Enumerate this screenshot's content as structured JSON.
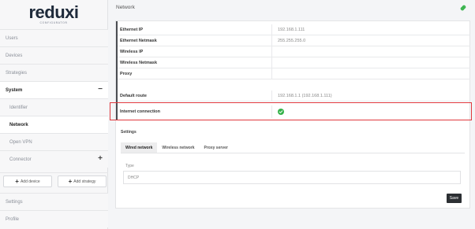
{
  "brand": {
    "logo": "reduxi",
    "tagline": "CONFIGURATOR"
  },
  "sidebar": {
    "items": [
      {
        "label": "Users"
      },
      {
        "label": "Devices"
      },
      {
        "label": "Strategies"
      },
      {
        "label": "System",
        "control": "−"
      },
      {
        "label": "Identifier"
      },
      {
        "label": "Network"
      },
      {
        "label": "Open VPN"
      },
      {
        "label": "Connector",
        "control": "+"
      }
    ],
    "add_device_label": "Add device",
    "add_strategy_label": "Add strategy",
    "settings_label": "Settings",
    "profile_label": "Profile"
  },
  "header": {
    "title": "Network",
    "link_icon": "link-icon"
  },
  "network": {
    "rows": [
      {
        "key": "Ethernet IP",
        "value": "192.168.1.111"
      },
      {
        "key": "Ethernet Netmask",
        "value": "255.255.255.0"
      },
      {
        "key": "Wireless IP",
        "value": ""
      },
      {
        "key": "Wireless Netmask",
        "value": ""
      },
      {
        "key": "Proxy",
        "value": ""
      },
      {
        "key": "Default route",
        "value": "192.168.1.1 (192.168.1.111)"
      },
      {
        "key": "Internet connection",
        "value": "",
        "status_icon": "check-circle-icon"
      }
    ]
  },
  "settings": {
    "label": "Settings",
    "tabs": [
      {
        "label": "Wired network"
      },
      {
        "label": "Wireless network"
      },
      {
        "label": "Proxy server"
      }
    ],
    "type_label": "Type",
    "type_value": "DHCP",
    "save_label": "Save"
  },
  "colors": {
    "highlight": "#e0393e",
    "ok": "#35b24a",
    "link": "#35b24a"
  }
}
